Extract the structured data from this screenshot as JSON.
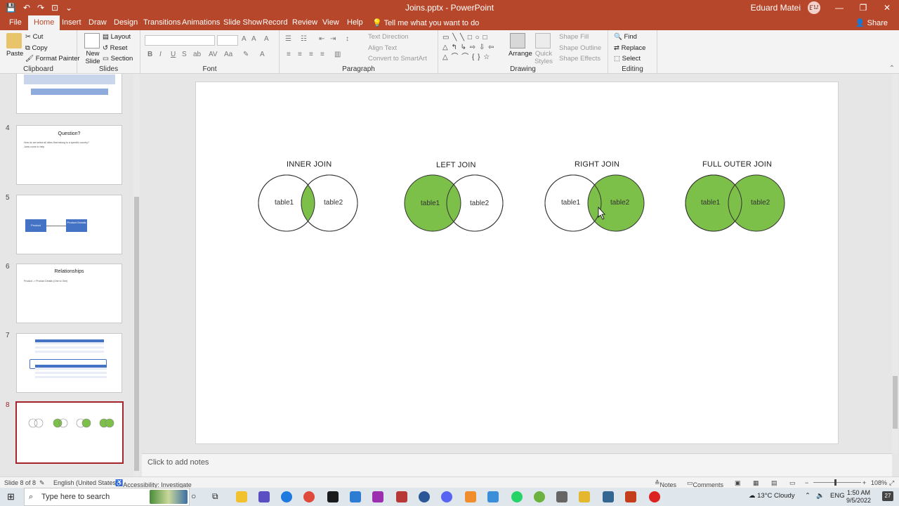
{
  "window": {
    "title": "Joins.pptx - PowerPoint",
    "user": "Eduard Matei",
    "avatar_initials": "EM",
    "controls": [
      "—",
      "▭",
      "❐",
      "✕"
    ]
  },
  "ribbon_tabs": [
    "File",
    "Home",
    "Insert",
    "Draw",
    "Design",
    "Transitions",
    "Animations",
    "Slide Show",
    "Record",
    "Review",
    "View",
    "Help"
  ],
  "tellme": "Tell me what you want to do",
  "share": "Share",
  "clipboard": {
    "paste": "Paste",
    "cut": "Cut",
    "copy": "Copy",
    "format_painter": "Format Painter",
    "label": "Clipboard"
  },
  "slides_grp": {
    "new_slide": "New Slide",
    "layout": "Layout",
    "reset": "Reset",
    "section": "Section",
    "label": "Slides"
  },
  "font_grp": {
    "label": "Font"
  },
  "paragraph_grp": {
    "text_direction": "Text Direction",
    "align_text": "Align Text",
    "smartart": "Convert to SmartArt",
    "label": "Paragraph"
  },
  "drawing_grp": {
    "arrange": "Arrange",
    "quick_styles": "Quick Styles",
    "shape_fill": "Shape Fill",
    "shape_outline": "Shape Outline",
    "shape_effects": "Shape Effects",
    "label": "Drawing"
  },
  "editing_grp": {
    "find": "Find",
    "replace": "Replace",
    "select": "Select",
    "label": "Editing"
  },
  "thumbnails": [
    {
      "num": "4",
      "title": "Question?",
      "bullets": [
        "How do we select all cities that belong to a specific country?",
        "Joins come to help"
      ]
    },
    {
      "num": "5",
      "box1": "Product",
      "box2": "Product Details"
    },
    {
      "num": "6",
      "title": "Relationships",
      "bullets": [
        "Product -> Product Details (One to One)"
      ]
    },
    {
      "num": "7"
    },
    {
      "num": "8"
    }
  ],
  "slide": {
    "joins": [
      {
        "title": "INNER JOIN",
        "left": "table1",
        "right": "table2",
        "fill": "intersection"
      },
      {
        "title": "LEFT JOIN",
        "left": "table1",
        "right": "table2",
        "fill": "left"
      },
      {
        "title": "RIGHT JOIN",
        "left": "table1",
        "right": "table2",
        "fill": "right"
      },
      {
        "title": "FULL OUTER JOIN",
        "left": "table1",
        "right": "table2",
        "fill": "both"
      }
    ],
    "green": "#7cbf49"
  },
  "notes_placeholder": "Click to add notes",
  "status": {
    "slide_of": "Slide 8 of 8",
    "language": "English (United States)",
    "accessibility": "Accessibility: Investigate",
    "notes": "Notes",
    "comments": "Comments",
    "zoom": "108%"
  },
  "taskbar": {
    "search": "Type here to search",
    "weather": "13°C  Cloudy",
    "lang": "ENG",
    "time": "1:50 AM",
    "date": "9/5/2022",
    "notif": "27"
  },
  "colors": {
    "accent": "#b7472a",
    "selection": "#a4262c"
  }
}
